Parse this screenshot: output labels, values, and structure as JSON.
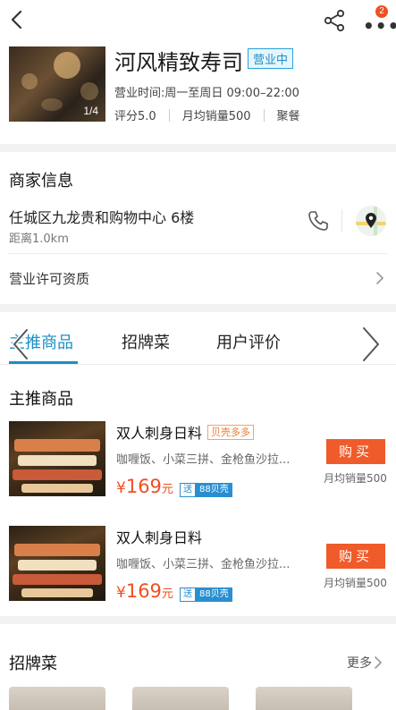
{
  "topbar": {
    "back_icon": "chevron-left-icon",
    "share_icon": "share-icon",
    "more_icon": "more-dots-icon",
    "notification_count": "2"
  },
  "store": {
    "name": "河风精致寿司",
    "status": "营业中",
    "photo_counter": "1/4",
    "hours": "营业时间:周一至周日 09:00–22:00",
    "rating": "评分5.0",
    "monthly_sales": "月均销量500",
    "category": "聚餐"
  },
  "merchant": {
    "title": "商家信息",
    "address": "任城区九龙贵和购物中心 6楼",
    "distance": "距离1.0km",
    "license": "营业许可资质"
  },
  "tabs": {
    "items": [
      "主推商品",
      "招牌菜",
      "用户评价"
    ],
    "active_index": 0
  },
  "recommended": {
    "title": "主推商品",
    "products": [
      {
        "name": "双人刺身日料",
        "tag": "贝壳多多",
        "desc": "咖喱饭、小菜三拼、金枪鱼沙拉...",
        "currency": "¥",
        "price": "169",
        "unit": "元",
        "gift_prefix": "送",
        "gift_amount": "88贝壳",
        "buy_label": "购买",
        "sales": "月均销量500"
      },
      {
        "name": "双人刺身日料",
        "tag": "",
        "desc": "咖喱饭、小菜三拼、金枪鱼沙拉...",
        "currency": "¥",
        "price": "169",
        "unit": "元",
        "gift_prefix": "送",
        "gift_amount": "88贝壳",
        "buy_label": "购买",
        "sales": "月均销量500"
      }
    ]
  },
  "signature": {
    "title": "招牌菜",
    "more_label": "更多"
  },
  "colors": {
    "accent_blue": "#1a8fc6",
    "price_red": "#f04e23",
    "buy_orange": "#ef5b2a"
  }
}
